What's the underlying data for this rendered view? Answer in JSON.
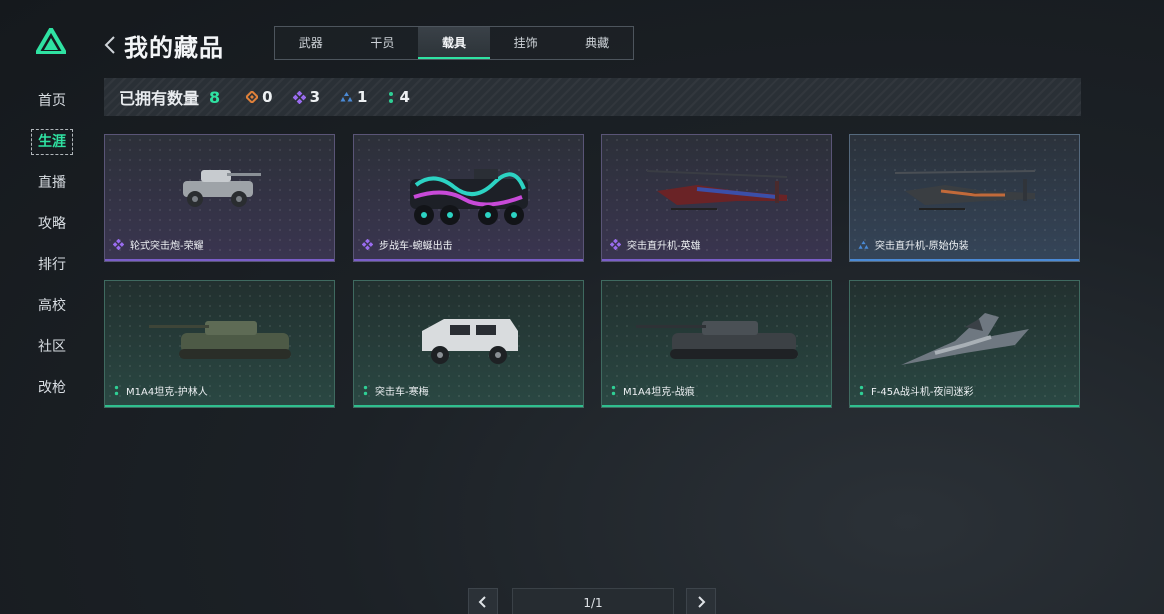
{
  "nav": [
    "首页",
    "生涯",
    "直播",
    "攻略",
    "排行",
    "高校",
    "社区",
    "改枪"
  ],
  "nav_active": "生涯",
  "header": {
    "title": "我的藏品"
  },
  "tabs": [
    "武器",
    "干员",
    "载具",
    "挂饰",
    "典藏"
  ],
  "tab_active": "载具",
  "stats": {
    "label": "已拥有数量",
    "total": "8",
    "rarities": [
      {
        "icon": "orange-diamond-icon",
        "color": "#e0813a",
        "count": "0"
      },
      {
        "icon": "purple-diamond-icon",
        "color": "#9a6cf0",
        "count": "3"
      },
      {
        "icon": "blue-triangle-icon",
        "color": "#4a8ad6",
        "count": "1"
      },
      {
        "icon": "green-dots-icon",
        "color": "#2fcf95",
        "count": "4"
      }
    ]
  },
  "items": [
    {
      "name": "轮式突击炮-荣耀",
      "rarity": "purple",
      "kind": "wheeled-tank"
    },
    {
      "name": "步战车-蜿蜒出击",
      "rarity": "purple",
      "kind": "ifv"
    },
    {
      "name": "突击直升机-英雄",
      "rarity": "purple",
      "kind": "helicopter"
    },
    {
      "name": "突击直升机-原始伪装",
      "rarity": "blue",
      "kind": "helicopter"
    },
    {
      "name": "M1A4坦克-护林人",
      "rarity": "green",
      "kind": "tank"
    },
    {
      "name": "突击车-寒梅",
      "rarity": "green",
      "kind": "truck"
    },
    {
      "name": "M1A4坦克-战痕",
      "rarity": "green",
      "kind": "tank"
    },
    {
      "name": "F-45A战斗机-夜间迷彩",
      "rarity": "green",
      "kind": "jet"
    }
  ],
  "pagination": {
    "page": "1/1"
  }
}
